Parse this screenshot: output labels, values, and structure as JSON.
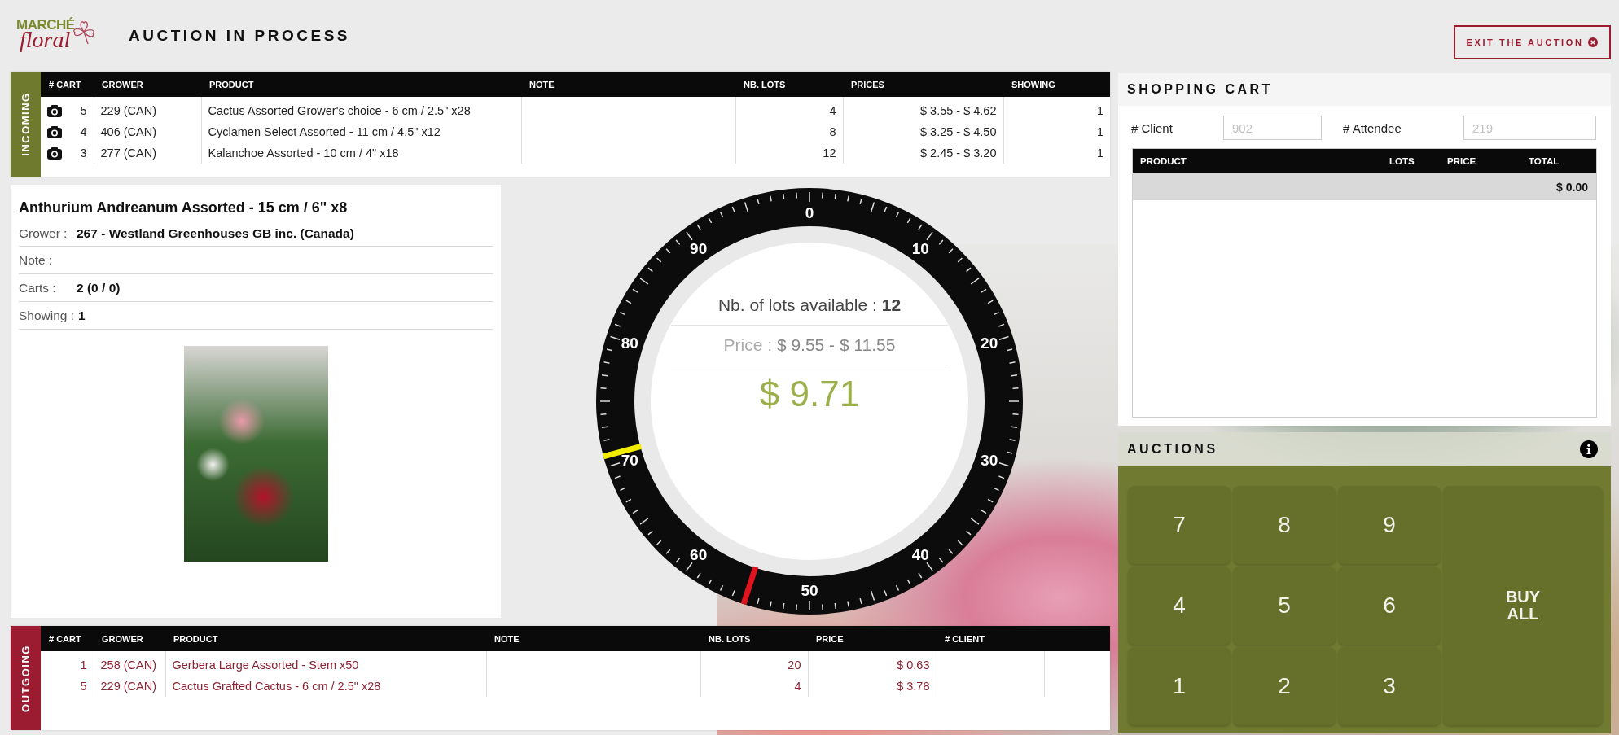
{
  "header": {
    "logo": {
      "line_1": "MARCHÉ",
      "line_2": "floral"
    },
    "title": "AUCTION IN PROCESS",
    "exit_button": "EXIT THE AUCTION"
  },
  "incoming": {
    "side_label": "INCOMING",
    "columns": [
      "# CART",
      "GROWER",
      "PRODUCT",
      "NOTE",
      "NB. LOTS",
      "PRICES",
      "SHOWING"
    ],
    "rows": [
      {
        "cart": "5",
        "grower": "229 (CAN)",
        "product": "Cactus Assorted Grower's choice - 6 cm / 2.5\" x28",
        "nb_lots": "4",
        "prices": "$ 3.55 - $ 4.62",
        "showing": "1"
      },
      {
        "cart": "4",
        "grower": "406 (CAN)",
        "product": "Cyclamen Select Assorted - 11 cm / 4.5\" x12",
        "nb_lots": "8",
        "prices": "$ 3.25 - $ 4.50",
        "showing": "1"
      },
      {
        "cart": "3",
        "grower": "277 (CAN)",
        "product": "Kalanchoe Assorted - 10 cm / 4\" x18",
        "nb_lots": "12",
        "prices": "$ 2.45 - $ 3.20",
        "showing": "1"
      }
    ]
  },
  "product": {
    "title": "Anthurium Andreanum Assorted - 15 cm / 6\" x8",
    "fields": [
      {
        "label": "Grower :",
        "value": "267 - Westland Greenhouses GB inc. (Canada)"
      },
      {
        "label": "Note :"
      },
      {
        "label": "Carts :",
        "value": "2 (0 / 0)"
      },
      {
        "label": "Showing :",
        "value": "1"
      }
    ]
  },
  "dial": {
    "labels": [
      "0",
      "10",
      "20",
      "30",
      "40",
      "50",
      "60",
      "70",
      "80",
      "90"
    ],
    "lots_text": "Nb. of lots available : **12**",
    "price_label": "Price :",
    "price_range": "$ 9.55 - $ 11.55",
    "current_price": "$ 9.71"
  },
  "outgoing": {
    "side_label": "OUTGOING",
    "columns": [
      "# CART",
      "GROWER",
      "PRODUCT",
      "NOTE",
      "NB. LOTS",
      "PRICE",
      "# CLIENT"
    ],
    "rows": [
      {
        "cart": "1",
        "grower": "258 (CAN)",
        "product": "Gerbera Large Assorted - Stem x50",
        "nb_lots": "20",
        "price": "$ 0.63"
      },
      {
        "cart": "5",
        "grower": "229 (CAN)",
        "product": "Cactus Grafted Cactus - 6 cm / 2.5\" x28",
        "nb_lots": "4",
        "price": "$ 3.78"
      }
    ]
  },
  "shopping_cart": {
    "title": "SHOPPING CART",
    "fields": [
      {
        "label": "# Client",
        "placeholder": "902"
      },
      {
        "label": "# Attendee",
        "placeholder": "219"
      }
    ],
    "columns": [
      "PRODUCT",
      "LOTS",
      "PRICE",
      "TOTAL"
    ],
    "total": "$ 0.00"
  },
  "auctions": {
    "title": "AUCTIONS",
    "keys": [
      "7",
      "8",
      "9",
      "4",
      "5",
      "6",
      "1",
      "2",
      "3"
    ],
    "buy_all": "BUY ALL"
  }
}
